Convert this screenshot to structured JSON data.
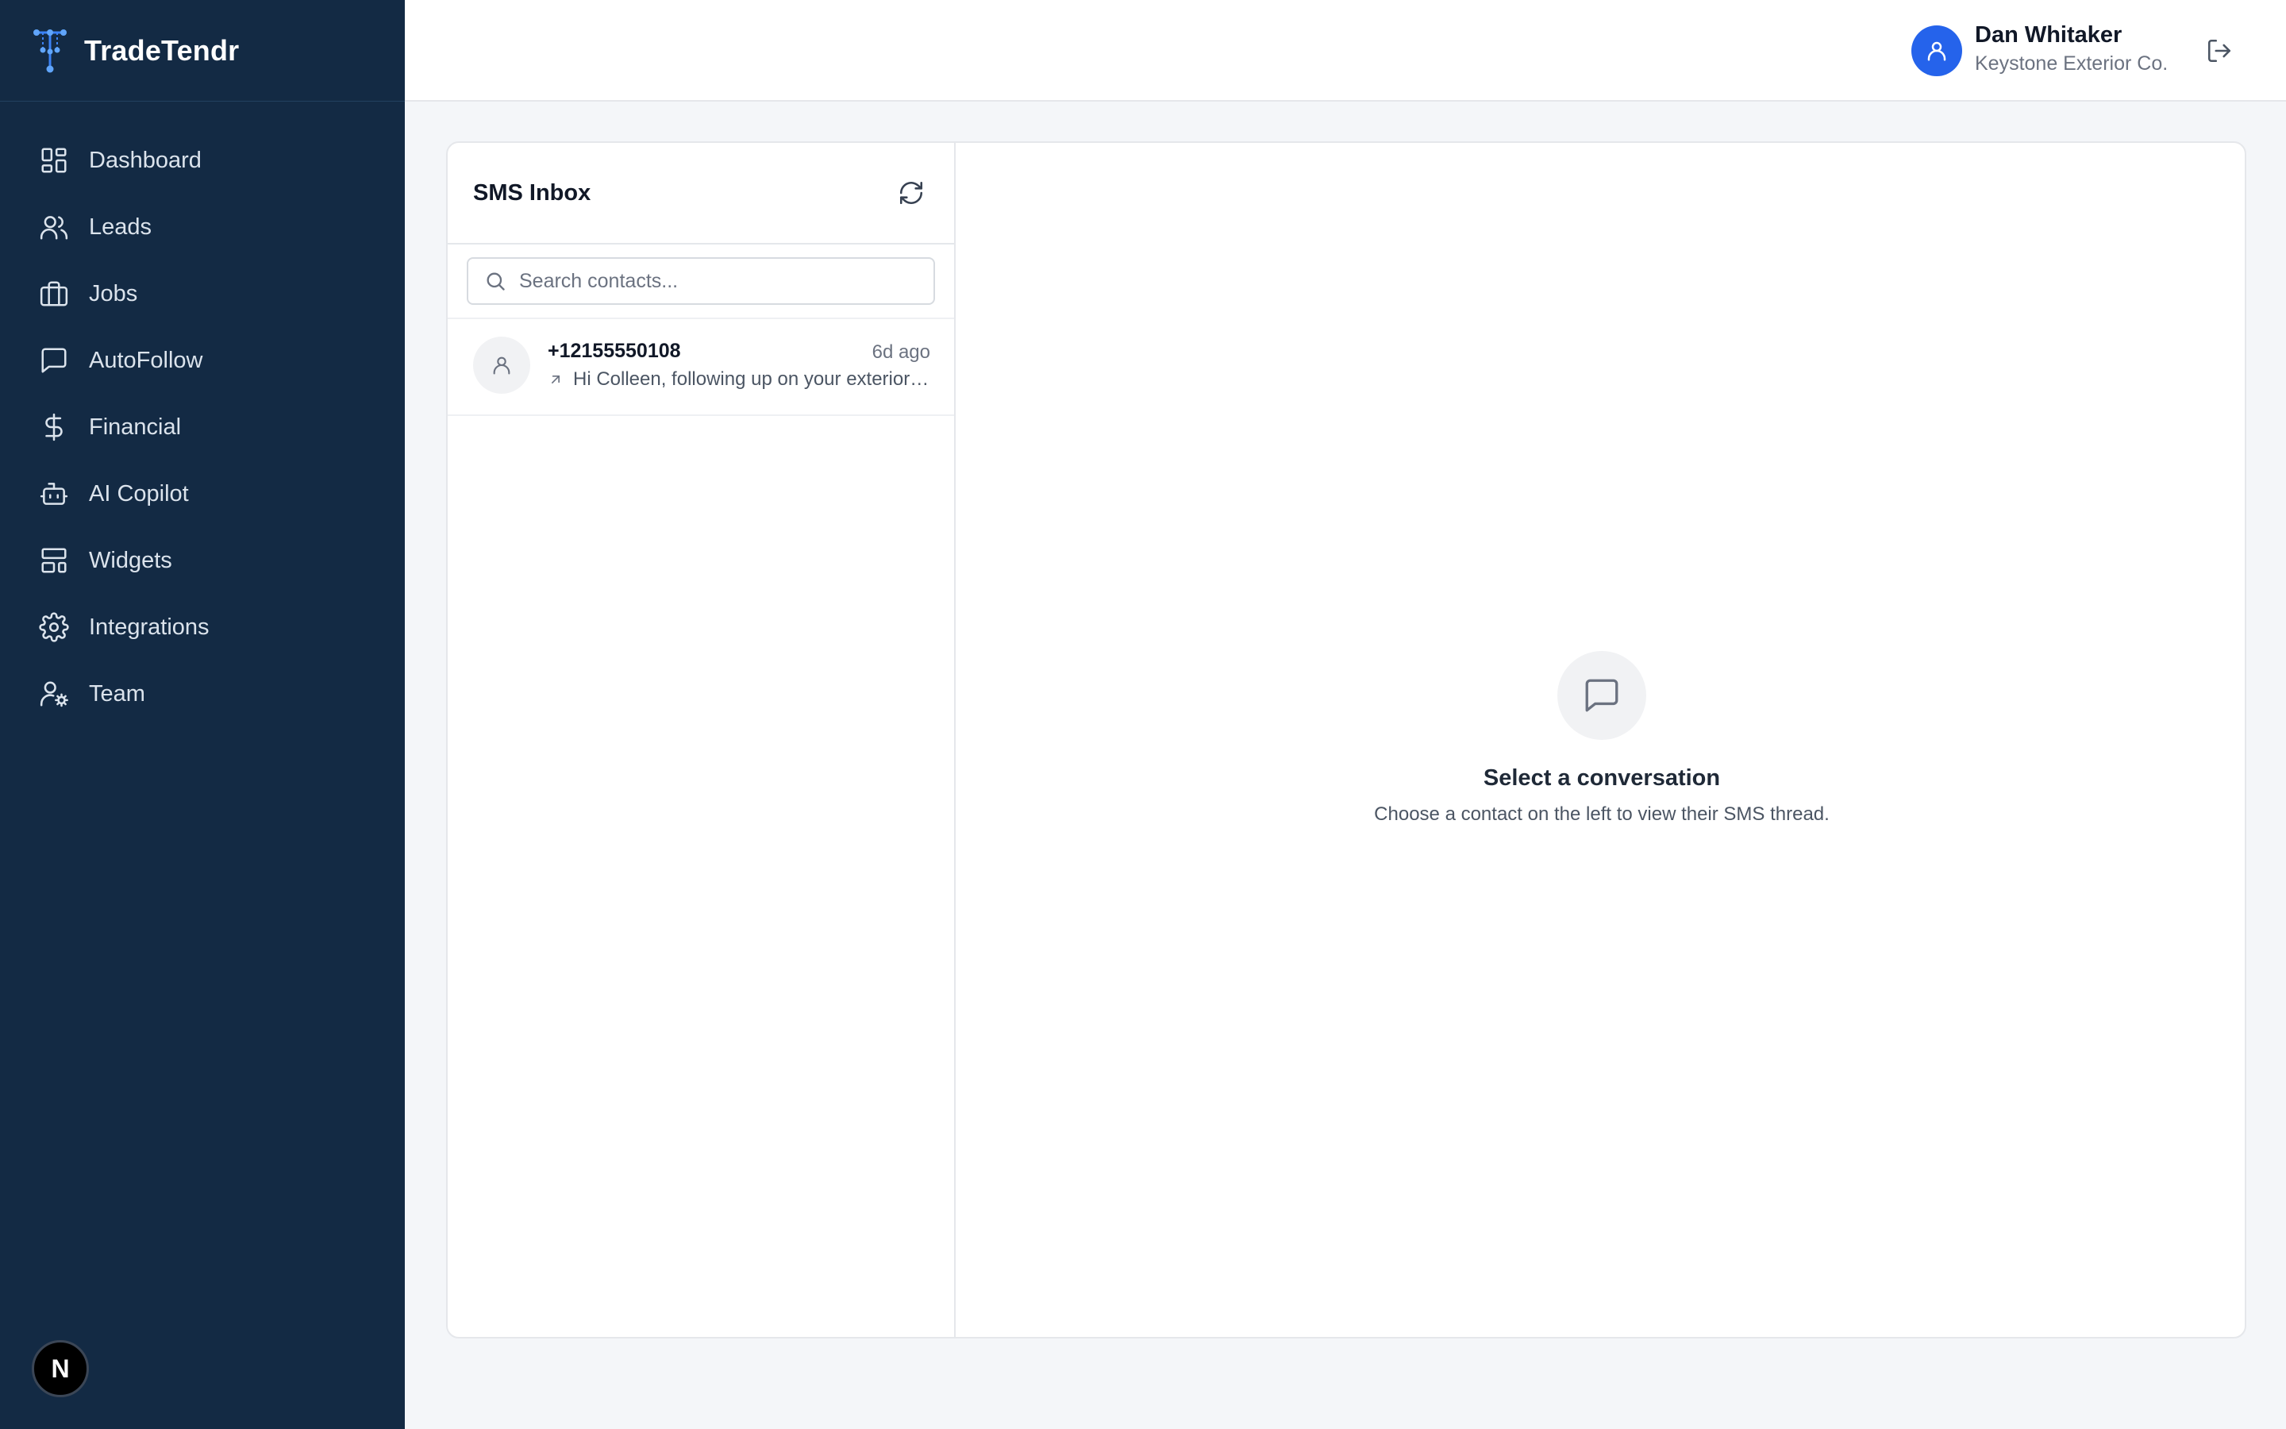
{
  "brand": {
    "name": "TradeTendr"
  },
  "sidebar": {
    "items": [
      {
        "label": "Dashboard",
        "icon": "dashboard-icon"
      },
      {
        "label": "Leads",
        "icon": "users-icon"
      },
      {
        "label": "Jobs",
        "icon": "briefcase-icon"
      },
      {
        "label": "AutoFollow",
        "icon": "message-square-icon"
      },
      {
        "label": "Financial",
        "icon": "dollar-sign-icon"
      },
      {
        "label": "AI Copilot",
        "icon": "bot-icon"
      },
      {
        "label": "Widgets",
        "icon": "layout-icon"
      },
      {
        "label": "Integrations",
        "icon": "gear-icon"
      },
      {
        "label": "Team",
        "icon": "user-cog-icon"
      }
    ],
    "bottom_badge": "N"
  },
  "header": {
    "user_name": "Dan Whitaker",
    "company": "Keystone Exterior Co."
  },
  "inbox": {
    "title": "SMS Inbox",
    "search_placeholder": "Search contacts...",
    "conversations": [
      {
        "phone": "+12155550108",
        "time": "6d ago",
        "preview": "Hi Colleen, following up on your exterior project estimate."
      }
    ]
  },
  "thread": {
    "empty_title": "Select a conversation",
    "empty_subtitle": "Choose a contact on the left to view their SMS thread."
  },
  "colors": {
    "sidebar_bg": "#132a44",
    "accent": "#2563eb",
    "page_bg": "#f4f6f9"
  }
}
